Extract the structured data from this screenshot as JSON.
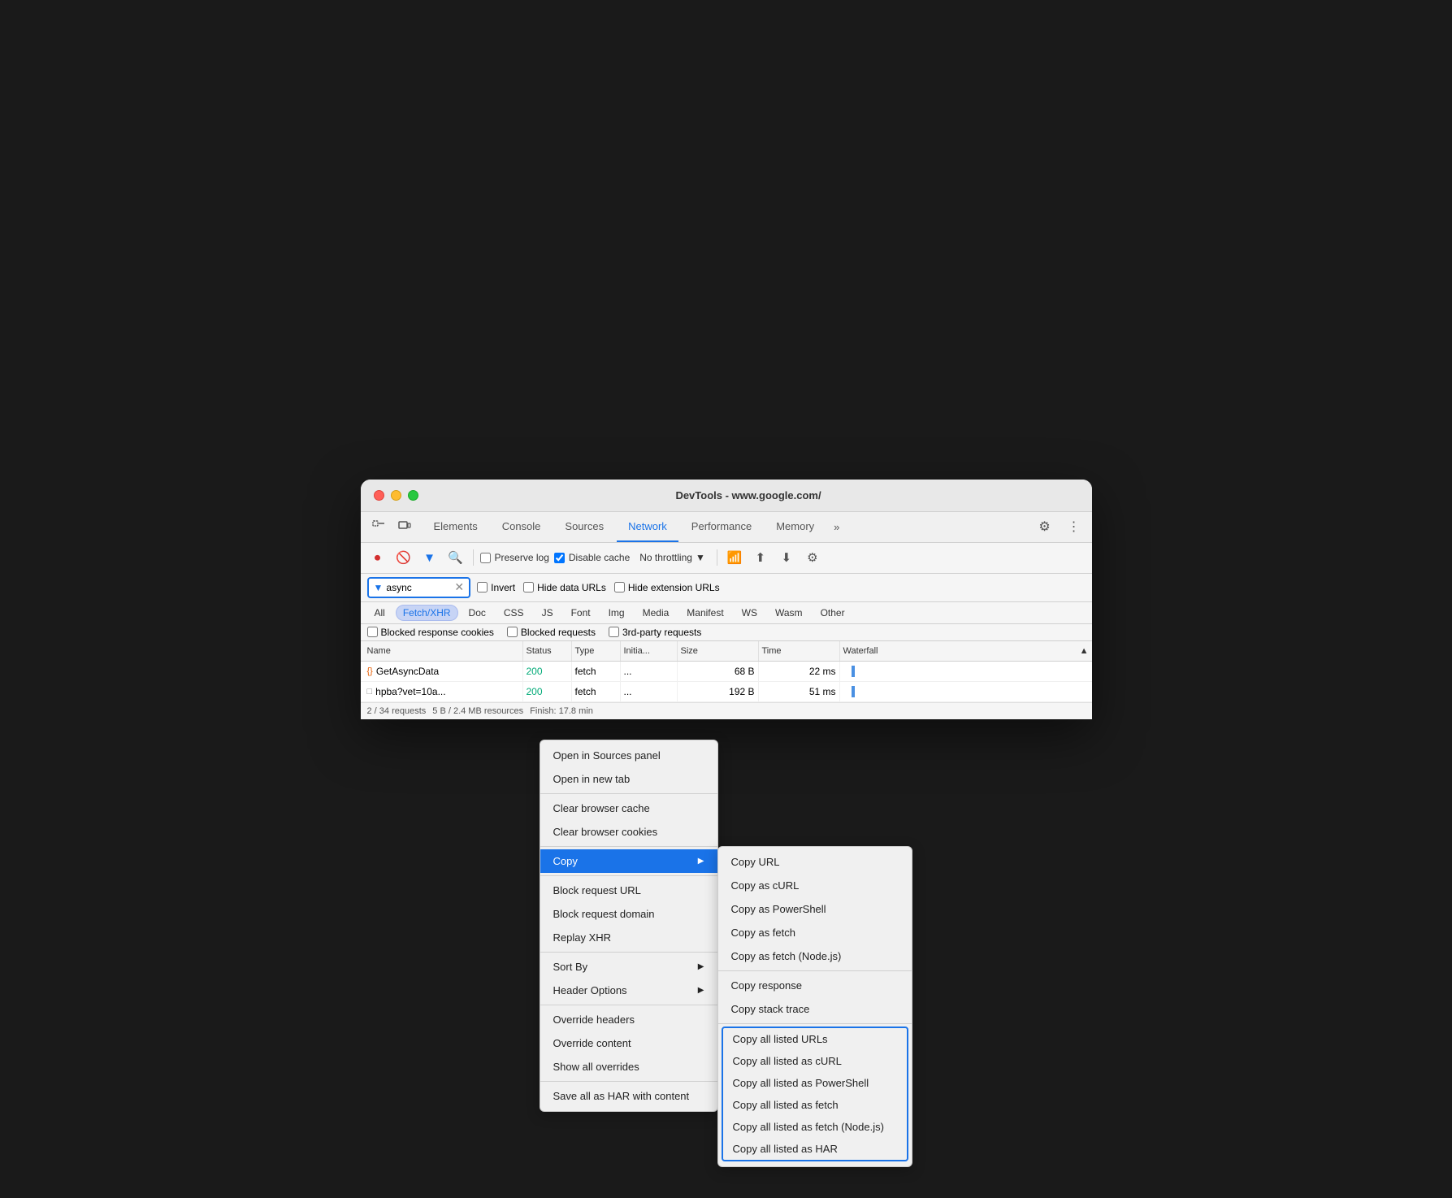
{
  "window": {
    "title": "DevTools - www.google.com/"
  },
  "tabs": {
    "items": [
      {
        "label": "Elements",
        "active": false
      },
      {
        "label": "Console",
        "active": false
      },
      {
        "label": "Sources",
        "active": false
      },
      {
        "label": "Network",
        "active": true
      },
      {
        "label": "Performance",
        "active": false
      },
      {
        "label": "Memory",
        "active": false
      }
    ],
    "more_label": "»"
  },
  "toolbar": {
    "preserve_log": "Preserve log",
    "disable_cache": "Disable cache",
    "throttle": "No throttling"
  },
  "filter": {
    "search_value": "async",
    "invert_label": "Invert",
    "hide_data_urls": "Hide data URLs",
    "hide_extension_urls": "Hide extension URLs"
  },
  "type_filters": {
    "items": [
      {
        "label": "All",
        "active": false
      },
      {
        "label": "Fetch/XHR",
        "active": true
      },
      {
        "label": "Doc",
        "active": false
      },
      {
        "label": "CSS",
        "active": false
      },
      {
        "label": "JS",
        "active": false
      },
      {
        "label": "Font",
        "active": false
      },
      {
        "label": "Img",
        "active": false
      },
      {
        "label": "Media",
        "active": false
      },
      {
        "label": "Manifest",
        "active": false
      },
      {
        "label": "WS",
        "active": false
      },
      {
        "label": "Wasm",
        "active": false
      },
      {
        "label": "Other",
        "active": false
      }
    ]
  },
  "blocked": {
    "items": [
      {
        "label": "Blocked response cookies"
      },
      {
        "label": "Blocked requests"
      },
      {
        "label": "3rd-party requests"
      }
    ]
  },
  "table": {
    "columns": [
      "Name",
      "Status",
      "Type",
      "Initia...",
      "Size",
      "Time",
      "Waterfall"
    ],
    "rows": [
      {
        "name": "GetAsyncData",
        "icon": "json",
        "status": "200",
        "type": "fetch",
        "initiator": "...",
        "size": "68 B",
        "time": "22 ms"
      },
      {
        "name": "hpba?vet=10a...",
        "icon": "doc",
        "status": "200",
        "type": "fetch",
        "initiator": "...",
        "size": "192 B",
        "time": "51 ms"
      }
    ]
  },
  "status_bar": {
    "requests": "2 / 34 requests",
    "resources": "5 B / 2.4 MB resources",
    "finish": "Finish: 17.8 min"
  },
  "context_menu": {
    "items": [
      {
        "label": "Open in Sources panel",
        "type": "item"
      },
      {
        "label": "Open in new tab",
        "type": "item"
      },
      {
        "type": "divider"
      },
      {
        "label": "Clear browser cache",
        "type": "item"
      },
      {
        "label": "Clear browser cookies",
        "type": "item"
      },
      {
        "type": "divider"
      },
      {
        "label": "Copy",
        "type": "submenu",
        "highlighted": true
      },
      {
        "type": "divider"
      },
      {
        "label": "Block request URL",
        "type": "item"
      },
      {
        "label": "Block request domain",
        "type": "item"
      },
      {
        "label": "Replay XHR",
        "type": "item"
      },
      {
        "type": "divider"
      },
      {
        "label": "Sort By",
        "type": "submenu"
      },
      {
        "label": "Header Options",
        "type": "submenu"
      },
      {
        "type": "divider"
      },
      {
        "label": "Override headers",
        "type": "item"
      },
      {
        "label": "Override content",
        "type": "item"
      },
      {
        "label": "Show all overrides",
        "type": "item"
      },
      {
        "type": "divider"
      },
      {
        "label": "Save all as HAR with content",
        "type": "item"
      }
    ]
  },
  "submenu": {
    "items": [
      {
        "label": "Copy URL",
        "outlined": false
      },
      {
        "label": "Copy as cURL",
        "outlined": false
      },
      {
        "label": "Copy as PowerShell",
        "outlined": false
      },
      {
        "label": "Copy as fetch",
        "outlined": false
      },
      {
        "label": "Copy as fetch (Node.js)",
        "outlined": false
      },
      {
        "type": "divider"
      },
      {
        "label": "Copy response",
        "outlined": false
      },
      {
        "label": "Copy stack trace",
        "outlined": false
      },
      {
        "type": "divider"
      },
      {
        "label": "Copy all listed URLs",
        "outlined": true
      },
      {
        "label": "Copy all listed as cURL",
        "outlined": true
      },
      {
        "label": "Copy all listed as PowerShell",
        "outlined": true
      },
      {
        "label": "Copy all listed as fetch",
        "outlined": true
      },
      {
        "label": "Copy all listed as fetch (Node.js)",
        "outlined": true
      },
      {
        "label": "Copy all listed as HAR",
        "outlined": true
      }
    ]
  }
}
